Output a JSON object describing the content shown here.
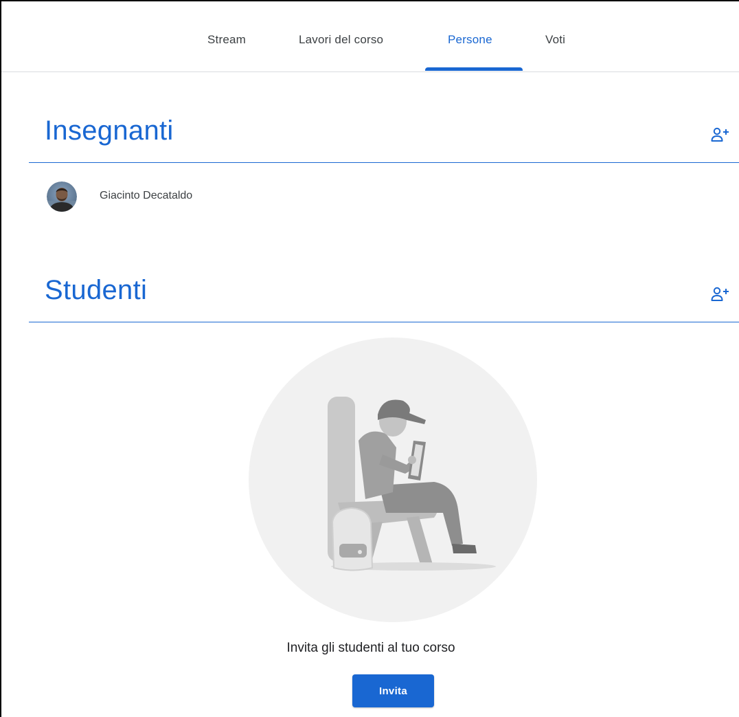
{
  "tabs": [
    {
      "label": "Stream",
      "active": false
    },
    {
      "label": "Lavori del corso",
      "active": false
    },
    {
      "label": "Persone",
      "active": true
    },
    {
      "label": "Voti",
      "active": false
    }
  ],
  "teachers": {
    "title": "Insegnanti",
    "add_icon": "person-add-icon",
    "list": [
      {
        "name": "Giacinto Decataldo",
        "avatar": "avatar-photo"
      }
    ]
  },
  "students": {
    "title": "Studenti",
    "add_icon": "person-add-icon",
    "empty_state": {
      "illustration": "student-reading-tablet-illustration",
      "message": "Invita gli studenti al tuo corso",
      "button_label": "Invita"
    }
  },
  "colors": {
    "accent": "#1967d2",
    "text": "#3c4043",
    "divider": "#dadce0"
  }
}
